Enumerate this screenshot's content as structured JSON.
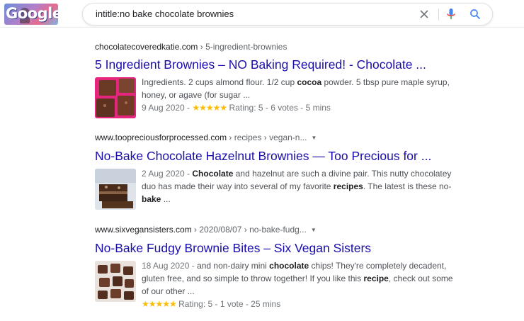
{
  "header": {
    "logo_text": "Google",
    "search_query": "intitle:no bake chocolate brownies",
    "icons": {
      "clear": "close-icon",
      "mic": "mic-icon",
      "search": "search-icon"
    },
    "colors": {
      "mic_blue": "#4285f4",
      "mic_red": "#ea4335",
      "search_blue": "#4285f4"
    }
  },
  "results": [
    {
      "site": "chocolatecoveredkatie.com",
      "path": " › 5-ingredient-brownies",
      "title": "5 Ingredient Brownies – NO Baking Required! - Chocolate ...",
      "snippet": [
        "Ingredients. 2 cups almond flour. 1/2 cup ",
        "cocoa",
        " powder. 5 tbsp pure maple syrup, honey, or agave (for sugar ..."
      ],
      "date": "9 Aug 2020 - ",
      "stars": "★★★★★",
      "rating_text": " Rating: 5 - 6 votes - 5 mins"
    },
    {
      "site": "www.toopreciousforprocessed.com",
      "path": " › recipes › vegan-n...",
      "title": "No-Bake Chocolate Hazelnut Brownies — Too Precious for ...",
      "date": "2 Aug 2020 - ",
      "snippet": [
        "Chocolate",
        " and hazelnut are such a divine pair. This nutty chocolatey duo has made their way into several of my favorite ",
        "recipes",
        ". The latest is these no-",
        "bake",
        " ..."
      ]
    },
    {
      "site": "www.sixvegansisters.com",
      "path": " › 2020/08/07 › no-bake-fudg...",
      "title": "No-Bake Fudgy Brownie Bites – Six Vegan Sisters",
      "date": "18 Aug 2020 - ",
      "snippet": [
        "and non-dairy mini ",
        "chocolate",
        " chips! They're completely decadent, gluten free, and so simple to throw together! If you like this ",
        "recipe",
        ", check out some of our other ..."
      ],
      "stars": "★★★★★",
      "rating_text": " Rating: 5 - 1 vote - 25 mins"
    }
  ],
  "colors": {
    "link": "#1a0dab",
    "star": "#fbbc04",
    "snippet": "#4d5156"
  }
}
